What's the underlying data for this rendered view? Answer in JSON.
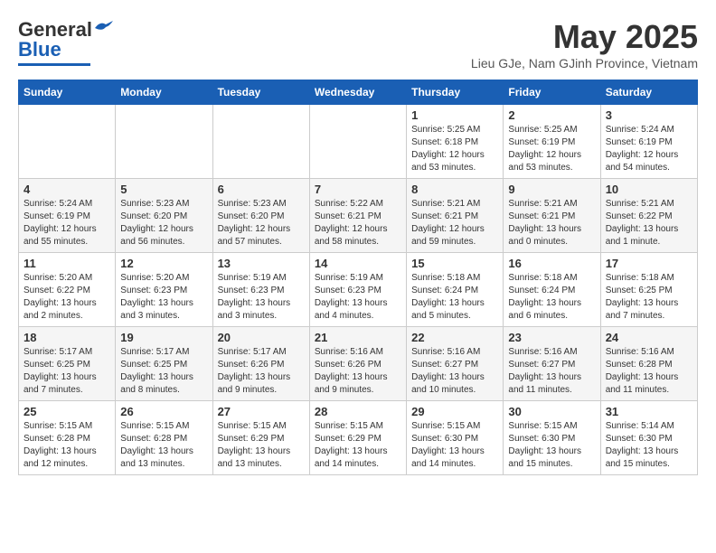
{
  "logo": {
    "general": "General",
    "blue": "Blue"
  },
  "header": {
    "month": "May 2025",
    "location": "Lieu GJe, Nam GJinh Province, Vietnam"
  },
  "days_of_week": [
    "Sunday",
    "Monday",
    "Tuesday",
    "Wednesday",
    "Thursday",
    "Friday",
    "Saturday"
  ],
  "weeks": [
    [
      {
        "day": "",
        "info": ""
      },
      {
        "day": "",
        "info": ""
      },
      {
        "day": "",
        "info": ""
      },
      {
        "day": "",
        "info": ""
      },
      {
        "day": "1",
        "info": "Sunrise: 5:25 AM\nSunset: 6:18 PM\nDaylight: 12 hours\nand 53 minutes."
      },
      {
        "day": "2",
        "info": "Sunrise: 5:25 AM\nSunset: 6:19 PM\nDaylight: 12 hours\nand 53 minutes."
      },
      {
        "day": "3",
        "info": "Sunrise: 5:24 AM\nSunset: 6:19 PM\nDaylight: 12 hours\nand 54 minutes."
      }
    ],
    [
      {
        "day": "4",
        "info": "Sunrise: 5:24 AM\nSunset: 6:19 PM\nDaylight: 12 hours\nand 55 minutes."
      },
      {
        "day": "5",
        "info": "Sunrise: 5:23 AM\nSunset: 6:20 PM\nDaylight: 12 hours\nand 56 minutes."
      },
      {
        "day": "6",
        "info": "Sunrise: 5:23 AM\nSunset: 6:20 PM\nDaylight: 12 hours\nand 57 minutes."
      },
      {
        "day": "7",
        "info": "Sunrise: 5:22 AM\nSunset: 6:21 PM\nDaylight: 12 hours\nand 58 minutes."
      },
      {
        "day": "8",
        "info": "Sunrise: 5:21 AM\nSunset: 6:21 PM\nDaylight: 12 hours\nand 59 minutes."
      },
      {
        "day": "9",
        "info": "Sunrise: 5:21 AM\nSunset: 6:21 PM\nDaylight: 13 hours\nand 0 minutes."
      },
      {
        "day": "10",
        "info": "Sunrise: 5:21 AM\nSunset: 6:22 PM\nDaylight: 13 hours\nand 1 minute."
      }
    ],
    [
      {
        "day": "11",
        "info": "Sunrise: 5:20 AM\nSunset: 6:22 PM\nDaylight: 13 hours\nand 2 minutes."
      },
      {
        "day": "12",
        "info": "Sunrise: 5:20 AM\nSunset: 6:23 PM\nDaylight: 13 hours\nand 3 minutes."
      },
      {
        "day": "13",
        "info": "Sunrise: 5:19 AM\nSunset: 6:23 PM\nDaylight: 13 hours\nand 3 minutes."
      },
      {
        "day": "14",
        "info": "Sunrise: 5:19 AM\nSunset: 6:23 PM\nDaylight: 13 hours\nand 4 minutes."
      },
      {
        "day": "15",
        "info": "Sunrise: 5:18 AM\nSunset: 6:24 PM\nDaylight: 13 hours\nand 5 minutes."
      },
      {
        "day": "16",
        "info": "Sunrise: 5:18 AM\nSunset: 6:24 PM\nDaylight: 13 hours\nand 6 minutes."
      },
      {
        "day": "17",
        "info": "Sunrise: 5:18 AM\nSunset: 6:25 PM\nDaylight: 13 hours\nand 7 minutes."
      }
    ],
    [
      {
        "day": "18",
        "info": "Sunrise: 5:17 AM\nSunset: 6:25 PM\nDaylight: 13 hours\nand 7 minutes."
      },
      {
        "day": "19",
        "info": "Sunrise: 5:17 AM\nSunset: 6:25 PM\nDaylight: 13 hours\nand 8 minutes."
      },
      {
        "day": "20",
        "info": "Sunrise: 5:17 AM\nSunset: 6:26 PM\nDaylight: 13 hours\nand 9 minutes."
      },
      {
        "day": "21",
        "info": "Sunrise: 5:16 AM\nSunset: 6:26 PM\nDaylight: 13 hours\nand 9 minutes."
      },
      {
        "day": "22",
        "info": "Sunrise: 5:16 AM\nSunset: 6:27 PM\nDaylight: 13 hours\nand 10 minutes."
      },
      {
        "day": "23",
        "info": "Sunrise: 5:16 AM\nSunset: 6:27 PM\nDaylight: 13 hours\nand 11 minutes."
      },
      {
        "day": "24",
        "info": "Sunrise: 5:16 AM\nSunset: 6:28 PM\nDaylight: 13 hours\nand 11 minutes."
      }
    ],
    [
      {
        "day": "25",
        "info": "Sunrise: 5:15 AM\nSunset: 6:28 PM\nDaylight: 13 hours\nand 12 minutes."
      },
      {
        "day": "26",
        "info": "Sunrise: 5:15 AM\nSunset: 6:28 PM\nDaylight: 13 hours\nand 13 minutes."
      },
      {
        "day": "27",
        "info": "Sunrise: 5:15 AM\nSunset: 6:29 PM\nDaylight: 13 hours\nand 13 minutes."
      },
      {
        "day": "28",
        "info": "Sunrise: 5:15 AM\nSunset: 6:29 PM\nDaylight: 13 hours\nand 14 minutes."
      },
      {
        "day": "29",
        "info": "Sunrise: 5:15 AM\nSunset: 6:30 PM\nDaylight: 13 hours\nand 14 minutes."
      },
      {
        "day": "30",
        "info": "Sunrise: 5:15 AM\nSunset: 6:30 PM\nDaylight: 13 hours\nand 15 minutes."
      },
      {
        "day": "31",
        "info": "Sunrise: 5:14 AM\nSunset: 6:30 PM\nDaylight: 13 hours\nand 15 minutes."
      }
    ]
  ]
}
